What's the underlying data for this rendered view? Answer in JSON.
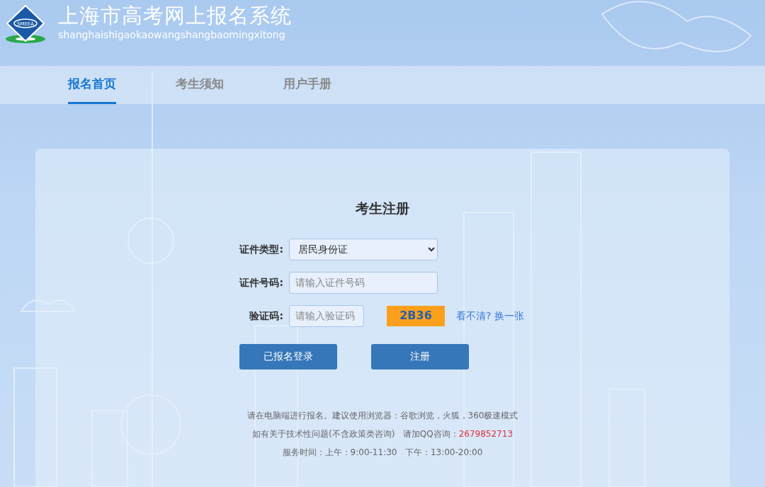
{
  "header": {
    "logo_text": "SMEEA",
    "title": "上海市高考网上报名系统",
    "subtitle": "shanghaishigaokaowangshangbaomingxitong"
  },
  "nav": [
    {
      "label": "报名首页",
      "selected": true
    },
    {
      "label": "考生须知",
      "selected": false
    },
    {
      "label": "用户手册",
      "selected": false
    }
  ],
  "form": {
    "title": "考生注册",
    "fields": [
      {
        "kind": "select",
        "label": "证件类型:",
        "value": "居民身份证"
      },
      {
        "kind": "input",
        "label": "证件号码:",
        "placeholder": "请输入证件号码"
      },
      {
        "kind": "captcha",
        "label": "验证码:",
        "placeholder": "请输入验证码",
        "captcha": "2B36",
        "refresh": "看不清? 换一张"
      }
    ],
    "buttons": [
      "已报名登录",
      "注册"
    ]
  },
  "footer": {
    "browser_note": "请在电脑端进行报名。建议使用浏览器：谷歌浏览，火狐，360极速模式",
    "support_note": "如有关于技术性问题(不含政策类咨询)   请加QQ咨询：",
    "qq": "2679852713",
    "hours": "服务时间：上午：9:00-11:30   下午：13:00-20:00"
  }
}
